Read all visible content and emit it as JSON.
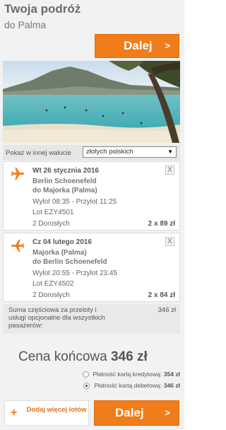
{
  "header": {
    "title": "Twoja podróż",
    "subtitle": "do Palma",
    "next_label": "Dalej",
    "next_chevron": ">"
  },
  "currency": {
    "label": "Pokaż w innej walucie",
    "selected": "złotych polskich"
  },
  "flights": [
    {
      "date": "Wt 26 stycznia 2016",
      "from": "Berlin Schoenefeld",
      "to": "do Majorka (Palma)",
      "times": "Wylot 08:35 - Przylot 11:25",
      "code": "Lot EZY4501",
      "passengers": "2 Dorosłych",
      "price": "2 x 89 zł",
      "close": "X",
      "icon": "airplane-icon"
    },
    {
      "date": "Cz 04 lutego 2016",
      "from": "Majorka (Palma)",
      "to": "do Berlin Schoenefeld",
      "times": "Wylot 20:55 - Przylot 23:45",
      "code": "Lot EZY4502",
      "passengers": "2 Dorosłych",
      "price": "2 x 84 zł",
      "close": "X",
      "icon": "airplane-icon"
    }
  ],
  "subtotal": {
    "label": "Suma częściowa za przeloty i usługi opcjonalne dla wszystkich pasażerów:",
    "value": "346 zł"
  },
  "final": {
    "label": "Cena końcowa",
    "amount": "346 zł"
  },
  "payment": [
    {
      "label": "Płatność kartą kredytową:",
      "amount": "354 zł",
      "selected": false
    },
    {
      "label": "Płatność kartą debetową:",
      "amount": "346 zł",
      "selected": true
    }
  ],
  "footer": {
    "add_plus": "+",
    "add_label": "Dodaj więcej lotów",
    "next_label": "Dalej",
    "next_chevron": ">"
  },
  "colors": {
    "accent": "#f07d1a",
    "panel": "#f2f2f2"
  }
}
